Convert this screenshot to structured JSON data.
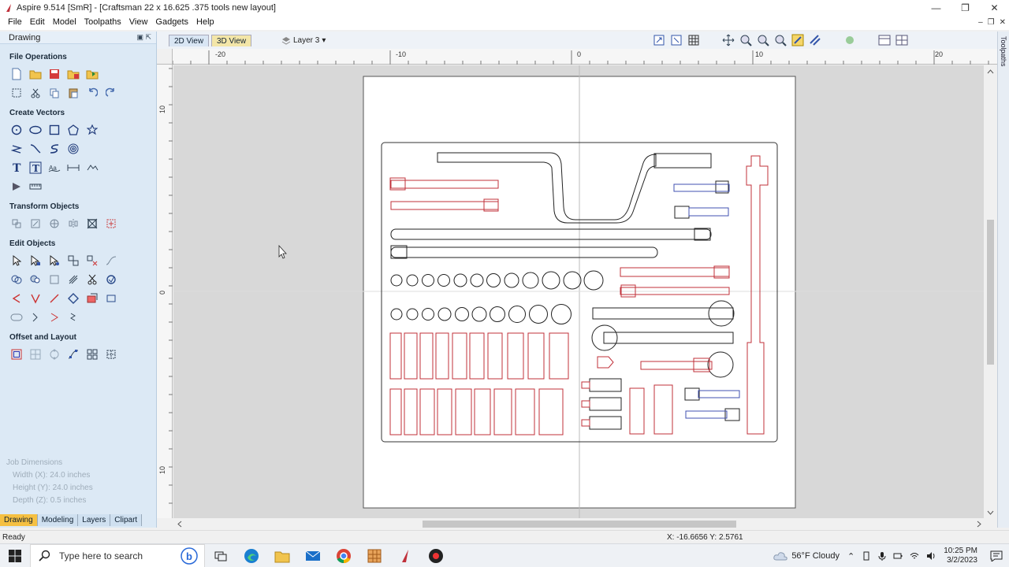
{
  "window": {
    "title": "Aspire 9.514 [SmR] - [Craftsman 22 x 16.625 .375 tools new layout]",
    "controls": {
      "minimize": "—",
      "restore": "❐",
      "close": "✕"
    },
    "mdi_controls": {
      "minimize": "–",
      "restore": "❐",
      "close": "✕"
    }
  },
  "menu": [
    "File",
    "Edit",
    "Model",
    "Toolpaths",
    "View",
    "Gadgets",
    "Help"
  ],
  "left_panel": {
    "header": "Drawing",
    "pins": "▣ ⇱",
    "sections": {
      "file_ops": "File Operations",
      "create_vectors": "Create Vectors",
      "transform": "Transform Objects",
      "edit": "Edit Objects",
      "offset": "Offset and Layout"
    },
    "job_dimensions": {
      "title": "Job Dimensions",
      "width": "Width  (X): 24.0 inches",
      "height": "Height (Y): 24.0 inches",
      "depth": "Depth  (Z): 0.5 inches"
    },
    "tabs": [
      "Drawing",
      "Modeling",
      "Layers",
      "Clipart"
    ]
  },
  "view": {
    "tab_2d": "2D View",
    "tab_3d": "3D View",
    "layer": "Layer 3",
    "layer_arrow": "▾"
  },
  "right_panel": {
    "label": "Toolpaths"
  },
  "rulers": {
    "h_labels": [
      "-20",
      "-10",
      "0",
      "10",
      "20"
    ],
    "v_labels": [
      "10",
      "0",
      "10"
    ]
  },
  "status": {
    "text": "Ready",
    "coords": "X: -16.6656 Y:  2.5761"
  },
  "taskbar": {
    "search_placeholder": "Type here to search",
    "weather": "56°F  Cloudy",
    "time": "10:25 PM",
    "date": "3/2/2023",
    "tray_caret": "⌃"
  },
  "colors": {
    "accent_tab": "#f5c042",
    "panel_bg": "#dce9f5",
    "vector_black": "#222222",
    "vector_red": "#c0303a",
    "vector_blue": "#4050b0"
  }
}
